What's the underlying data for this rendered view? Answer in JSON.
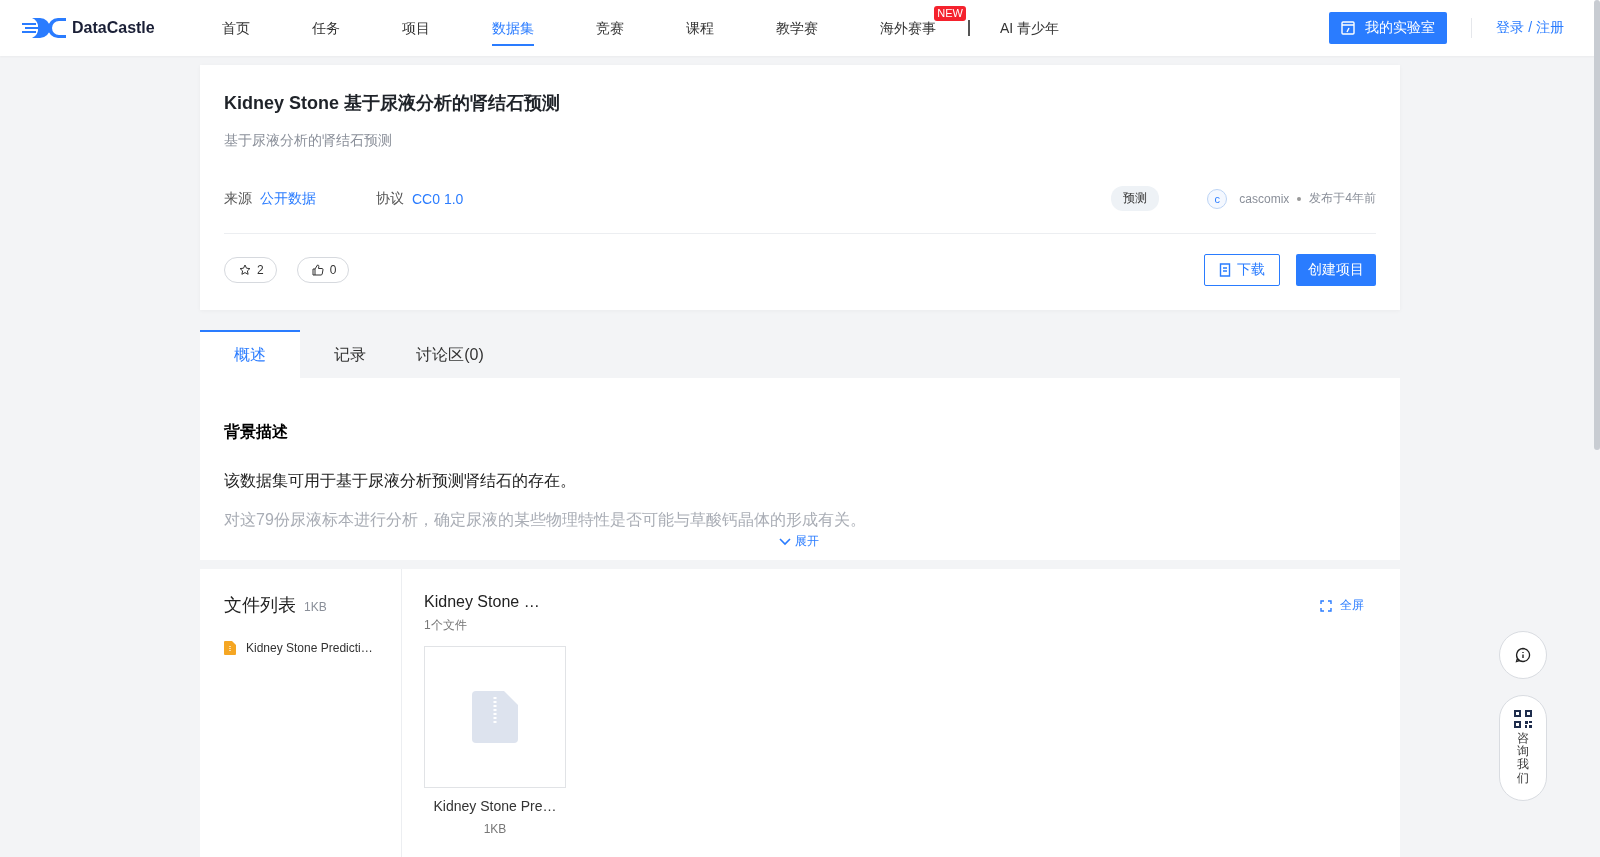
{
  "header": {
    "logo": "DataCastle",
    "nav": [
      {
        "label": "首页",
        "selected": false
      },
      {
        "label": "任务",
        "selected": false
      },
      {
        "label": "项目",
        "selected": false
      },
      {
        "label": "数据集",
        "selected": true
      },
      {
        "label": "竞赛",
        "selected": false
      },
      {
        "label": "课程",
        "selected": false
      },
      {
        "label": "教学赛",
        "selected": false
      },
      {
        "label": "海外赛事",
        "selected": false,
        "badge": "NEW"
      },
      {
        "label": "AI 青少年",
        "selected": false,
        "divider_before": true
      }
    ],
    "lab_button": "我的实验室",
    "login": "登录 / 注册"
  },
  "dataset": {
    "title": "Kidney Stone 基于尿液分析的肾结石预测",
    "subtitle": "基于尿液分析的肾结石预测",
    "source_label": "来源",
    "source": "公开数据",
    "license_label": "协议",
    "license": "CC0 1.0",
    "tag": "预测",
    "avatar": "c",
    "author": "cascomix",
    "published": "发布于4年前",
    "stars": "2",
    "likes": "0",
    "download": "下载",
    "create": "创建项目"
  },
  "tabs": [
    {
      "label": "概述",
      "selected": true
    },
    {
      "label": "记录",
      "selected": false
    },
    {
      "label": "讨论区(0)",
      "selected": false
    }
  ],
  "overview": {
    "heading": "背景描述",
    "paragraphs": [
      "该数据集可用于基于尿液分析预测肾结石的存在。",
      "对这79份尿液标本进行分析，确定尿液的某些物理特性是否可能与草酸钙晶体的形成有关。"
    ],
    "expand": "展开"
  },
  "files": {
    "title": "文件列表",
    "size": "1KB",
    "items": [
      {
        "name": "Kidney Stone Predicti…"
      }
    ],
    "folder": "Kidney Stone …",
    "count": "1个文件",
    "fullscreen": "全屏",
    "cards": [
      {
        "name": "Kidney Stone Pre…",
        "size": "1KB"
      }
    ]
  },
  "float": {
    "contact": "咨询我们"
  }
}
